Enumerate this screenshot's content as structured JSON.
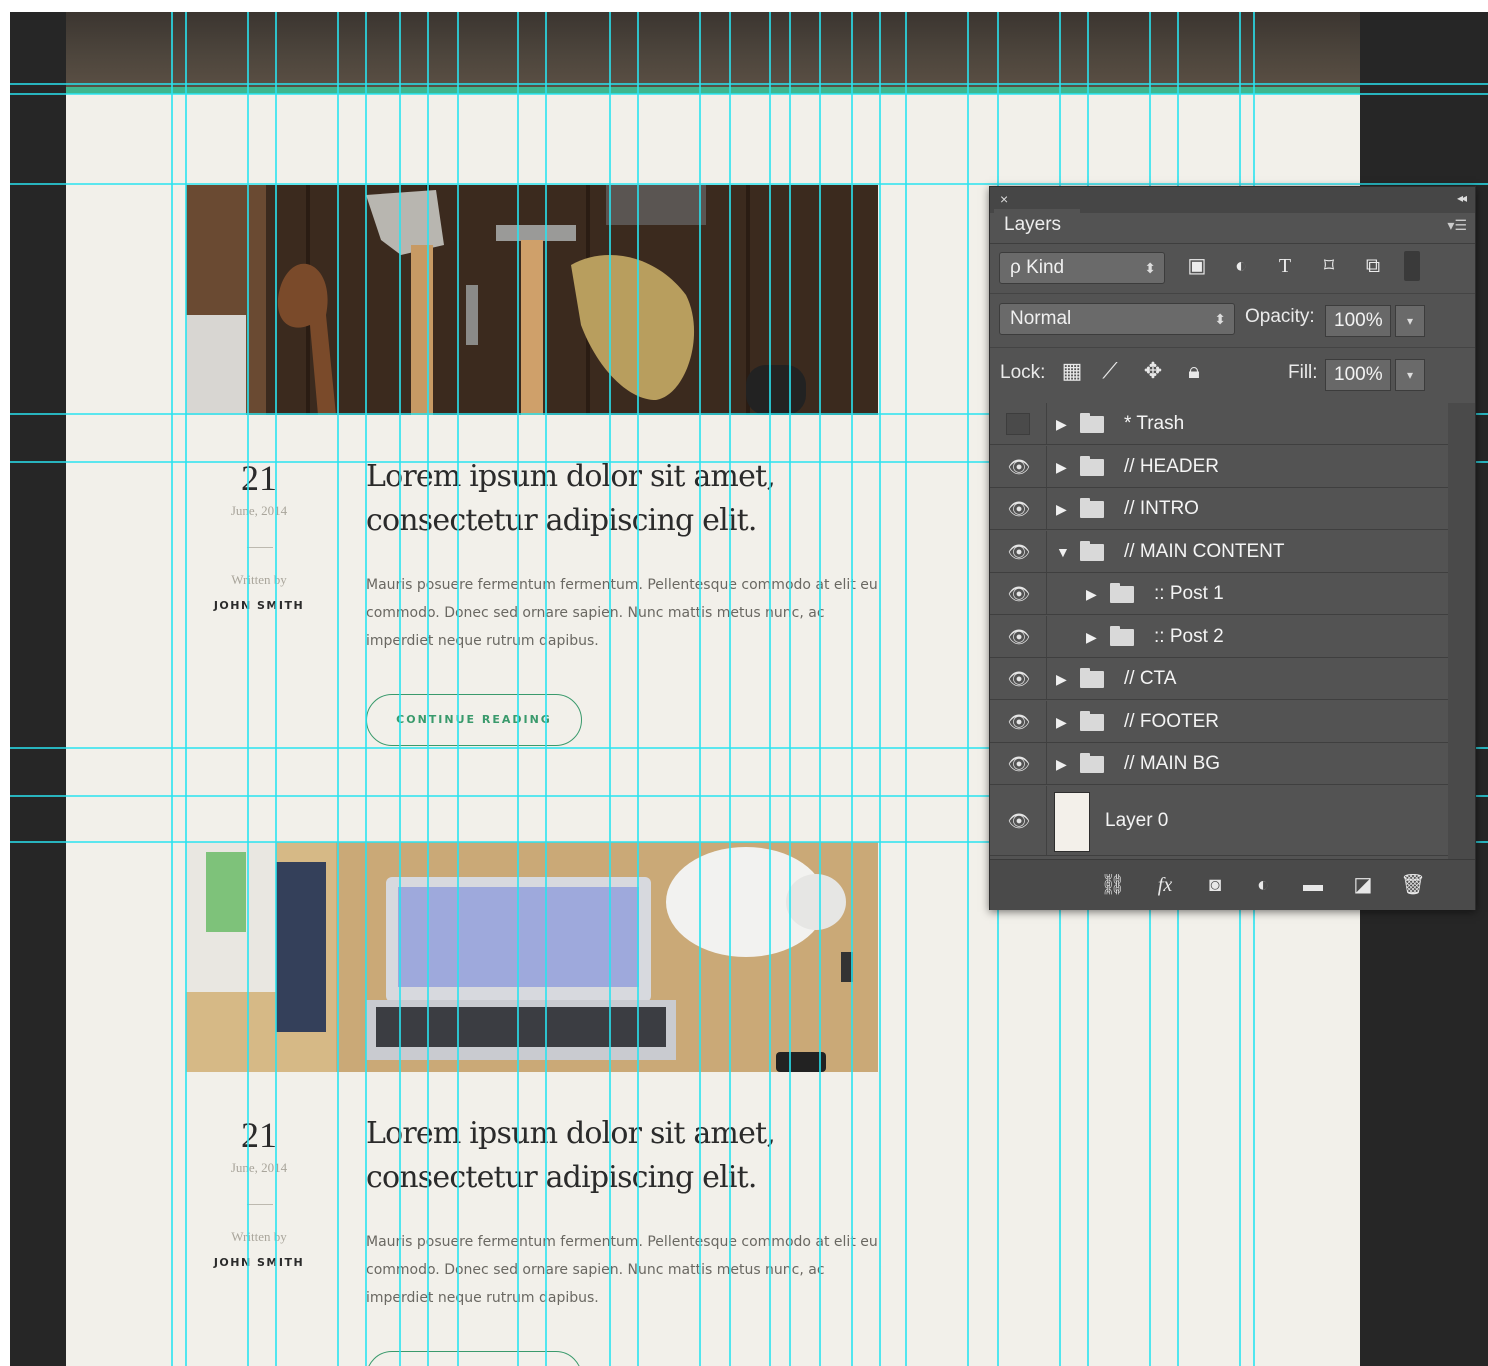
{
  "posts": [
    {
      "day": "21",
      "date": "June, 2014",
      "written_by": "Written by",
      "author": "JOHN SMITH",
      "title": "Lorem ipsum dolor sit amet, consectetur adipiscing elit.",
      "excerpt": "Mauris posuere fermentum fermentum. Pellentesque commodo at elit eu commodo. Donec sed ornare sapien. Nunc mattis metus nunc, ac imperdiet neque rutrum dapibus.",
      "cta": "CONTINUE READING"
    },
    {
      "day": "21",
      "date": "June, 2014",
      "written_by": "Written by",
      "author": "JOHN SMITH",
      "title": "Lorem ipsum dolor sit amet, consectetur adipiscing elit.",
      "excerpt": "Mauris posuere fermentum fermentum. Pellentesque commodo at elit eu commodo. Donec sed ornare sapien. Nunc mattis metus nunc, ac imperdiet neque rutrum dapibus."
    }
  ],
  "layers_panel": {
    "close_glyph": "×",
    "collapse_glyph": "◂◂",
    "tab": "Layers",
    "filter_kind": "ρ Kind",
    "blend_mode": "Normal",
    "opacity_label": "Opacity:",
    "opacity_value": "100%",
    "lock_label": "Lock:",
    "fill_label": "Fill:",
    "fill_value": "100%",
    "layers": [
      {
        "name": "* Trash",
        "visible": false,
        "expanded": false,
        "indent": 0
      },
      {
        "name": "// HEADER",
        "visible": true,
        "expanded": false,
        "indent": 0
      },
      {
        "name": "// INTRO",
        "visible": true,
        "expanded": false,
        "indent": 0
      },
      {
        "name": "// MAIN CONTENT",
        "visible": true,
        "expanded": true,
        "indent": 0
      },
      {
        "name": ":: Post 1",
        "visible": true,
        "expanded": false,
        "indent": 1
      },
      {
        "name": ":: Post 2",
        "visible": true,
        "expanded": false,
        "indent": 1
      },
      {
        "name": "// CTA",
        "visible": true,
        "expanded": false,
        "indent": 0
      },
      {
        "name": "// FOOTER",
        "visible": true,
        "expanded": false,
        "indent": 0
      },
      {
        "name": "// MAIN BG",
        "visible": true,
        "expanded": false,
        "indent": 0
      },
      {
        "name": "Layer 0",
        "visible": true,
        "expanded": false,
        "indent": 0
      }
    ]
  },
  "colors": {
    "guide": "#29e3f0",
    "accent_green": "#3a9a6c",
    "page_bg": "#f2f0ea",
    "canvas_bg": "#262626",
    "panel_bg": "#535353"
  }
}
